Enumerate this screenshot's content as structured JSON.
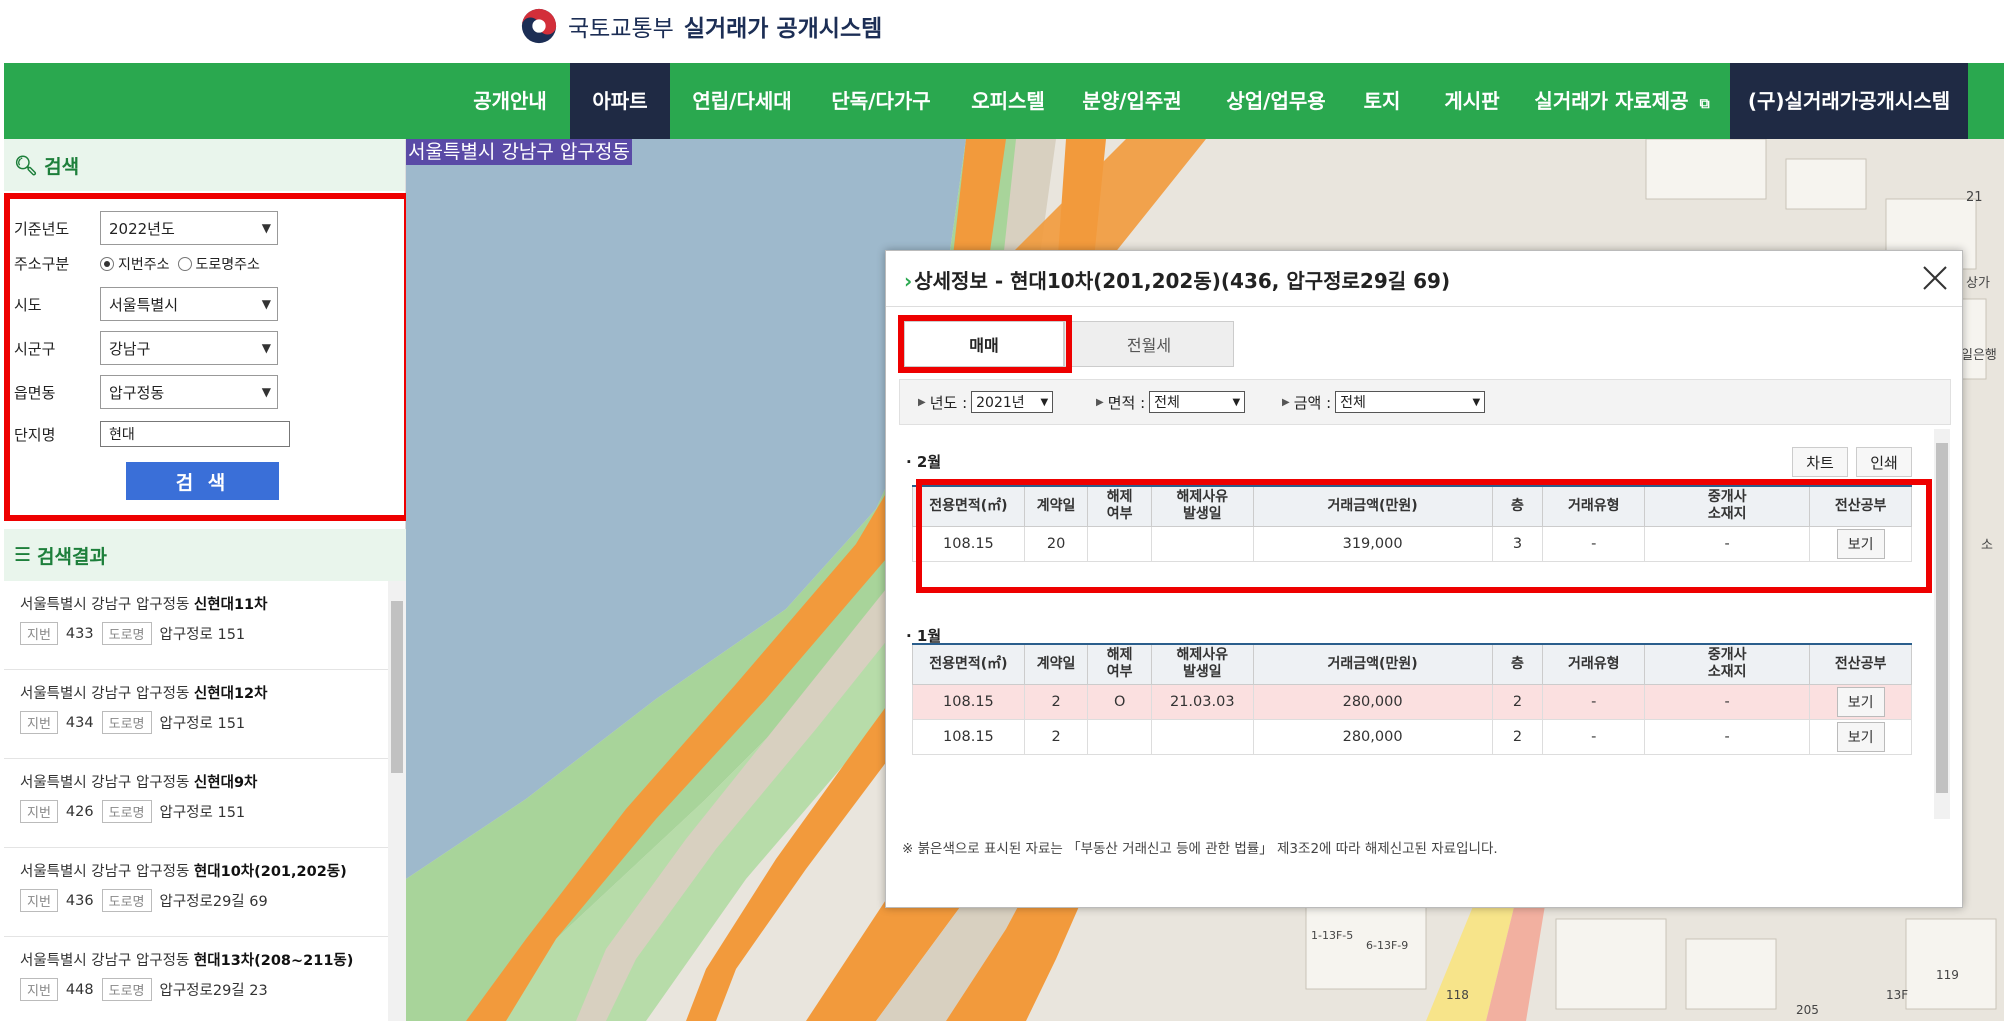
{
  "header": {
    "ministry": "국토교통부",
    "system_name": "실거래가 공개시스템"
  },
  "nav": {
    "items": [
      "공개안내",
      "아파트",
      "연립/다세대",
      "단독/다가구",
      "오피스텔",
      "분양/입주권",
      "상업/업무용",
      "토지",
      "게시판",
      "실거래가 자료제공"
    ],
    "old_system": "(구)실거래가공개시스템",
    "active": "아파트"
  },
  "search": {
    "title": "검색",
    "year_label": "기준년도",
    "year_value": "2022년도",
    "addr_type_label": "주소구분",
    "addr_type_lot": "지번주소",
    "addr_type_road": "도로명주소",
    "addr_type_selected": "지번주소",
    "sido_label": "시도",
    "sido_value": "서울특별시",
    "sigungu_label": "시군구",
    "sigungu_value": "강남구",
    "dong_label": "읍면동",
    "dong_value": "압구정동",
    "complex_label": "단지명",
    "complex_value": "현대",
    "button": "검 색"
  },
  "results": {
    "title": "검색결과",
    "lot_tag": "지번",
    "road_tag": "도로명",
    "items": [
      {
        "prefix": "서울특별시 강남구 압구정동",
        "name": "신현대11차",
        "lot": "433",
        "road": "압구정로 151"
      },
      {
        "prefix": "서울특별시 강남구 압구정동",
        "name": "신현대12차",
        "lot": "434",
        "road": "압구정로 151"
      },
      {
        "prefix": "서울특별시 강남구 압구정동",
        "name": "신현대9차",
        "lot": "426",
        "road": "압구정로 151"
      },
      {
        "prefix": "서울특별시 강남구 압구정동",
        "name": "현대10차(201,202동)",
        "lot": "436",
        "road": "압구정로29길 69"
      },
      {
        "prefix": "서울특별시 강남구 압구정동",
        "name": "현대13차(208~211동)",
        "lot": "448",
        "road": "압구정로29길 23"
      }
    ]
  },
  "map": {
    "location_label": "서울특별시 강남구 압구정동",
    "labels": [
      "21",
      "상가",
      "일은행",
      "소",
      "118",
      "13F",
      "119",
      "1-13F-5",
      "6-13F-9",
      "205"
    ]
  },
  "dialog": {
    "title": "상세정보 - 현대10차(201,202동)(436, 압구정로29길 69)",
    "tabs": [
      "매매",
      "전월세"
    ],
    "active_tab": "매매",
    "filters": {
      "year_label": "년도 :",
      "year_value": "2021년",
      "area_label": "면적 :",
      "area_value": "전체",
      "price_label": "금액 :",
      "price_value": "전체"
    },
    "chart_button": "차트",
    "print_button": "인쇄",
    "columns": [
      "전용면적(㎡)",
      "계약일",
      "해제\n여부",
      "해제사유\n발생일",
      "거래금액(만원)",
      "층",
      "거래유형",
      "중개사\n소재지",
      "전산공부"
    ],
    "view_label": "보기",
    "months": [
      {
        "label": "· 2월",
        "rows": [
          {
            "area": "108.15",
            "day": "20",
            "cancel": "",
            "cancel_date": "",
            "price": "319,000",
            "floor": "3",
            "type": "-",
            "agent": "-",
            "cancelled": false
          }
        ]
      },
      {
        "label": "· 1월",
        "rows": [
          {
            "area": "108.15",
            "day": "2",
            "cancel": "O",
            "cancel_date": "21.03.03",
            "price": "280,000",
            "floor": "2",
            "type": "-",
            "agent": "-",
            "cancelled": true
          },
          {
            "area": "108.15",
            "day": "2",
            "cancel": "",
            "cancel_date": "",
            "price": "280,000",
            "floor": "2",
            "type": "-",
            "agent": "-",
            "cancelled": false
          }
        ]
      }
    ],
    "note": "※ 붉은색으로 표시된 자료는 「부동산 거래신고 등에 관한 법률」 제3조2에 따라 해제신고된 자료입니다."
  },
  "colors": {
    "nav_green": "#2aa84f",
    "nav_dark": "#1f2a44",
    "highlight_red": "#e00000",
    "cancel_row": "#fbe0e0"
  }
}
